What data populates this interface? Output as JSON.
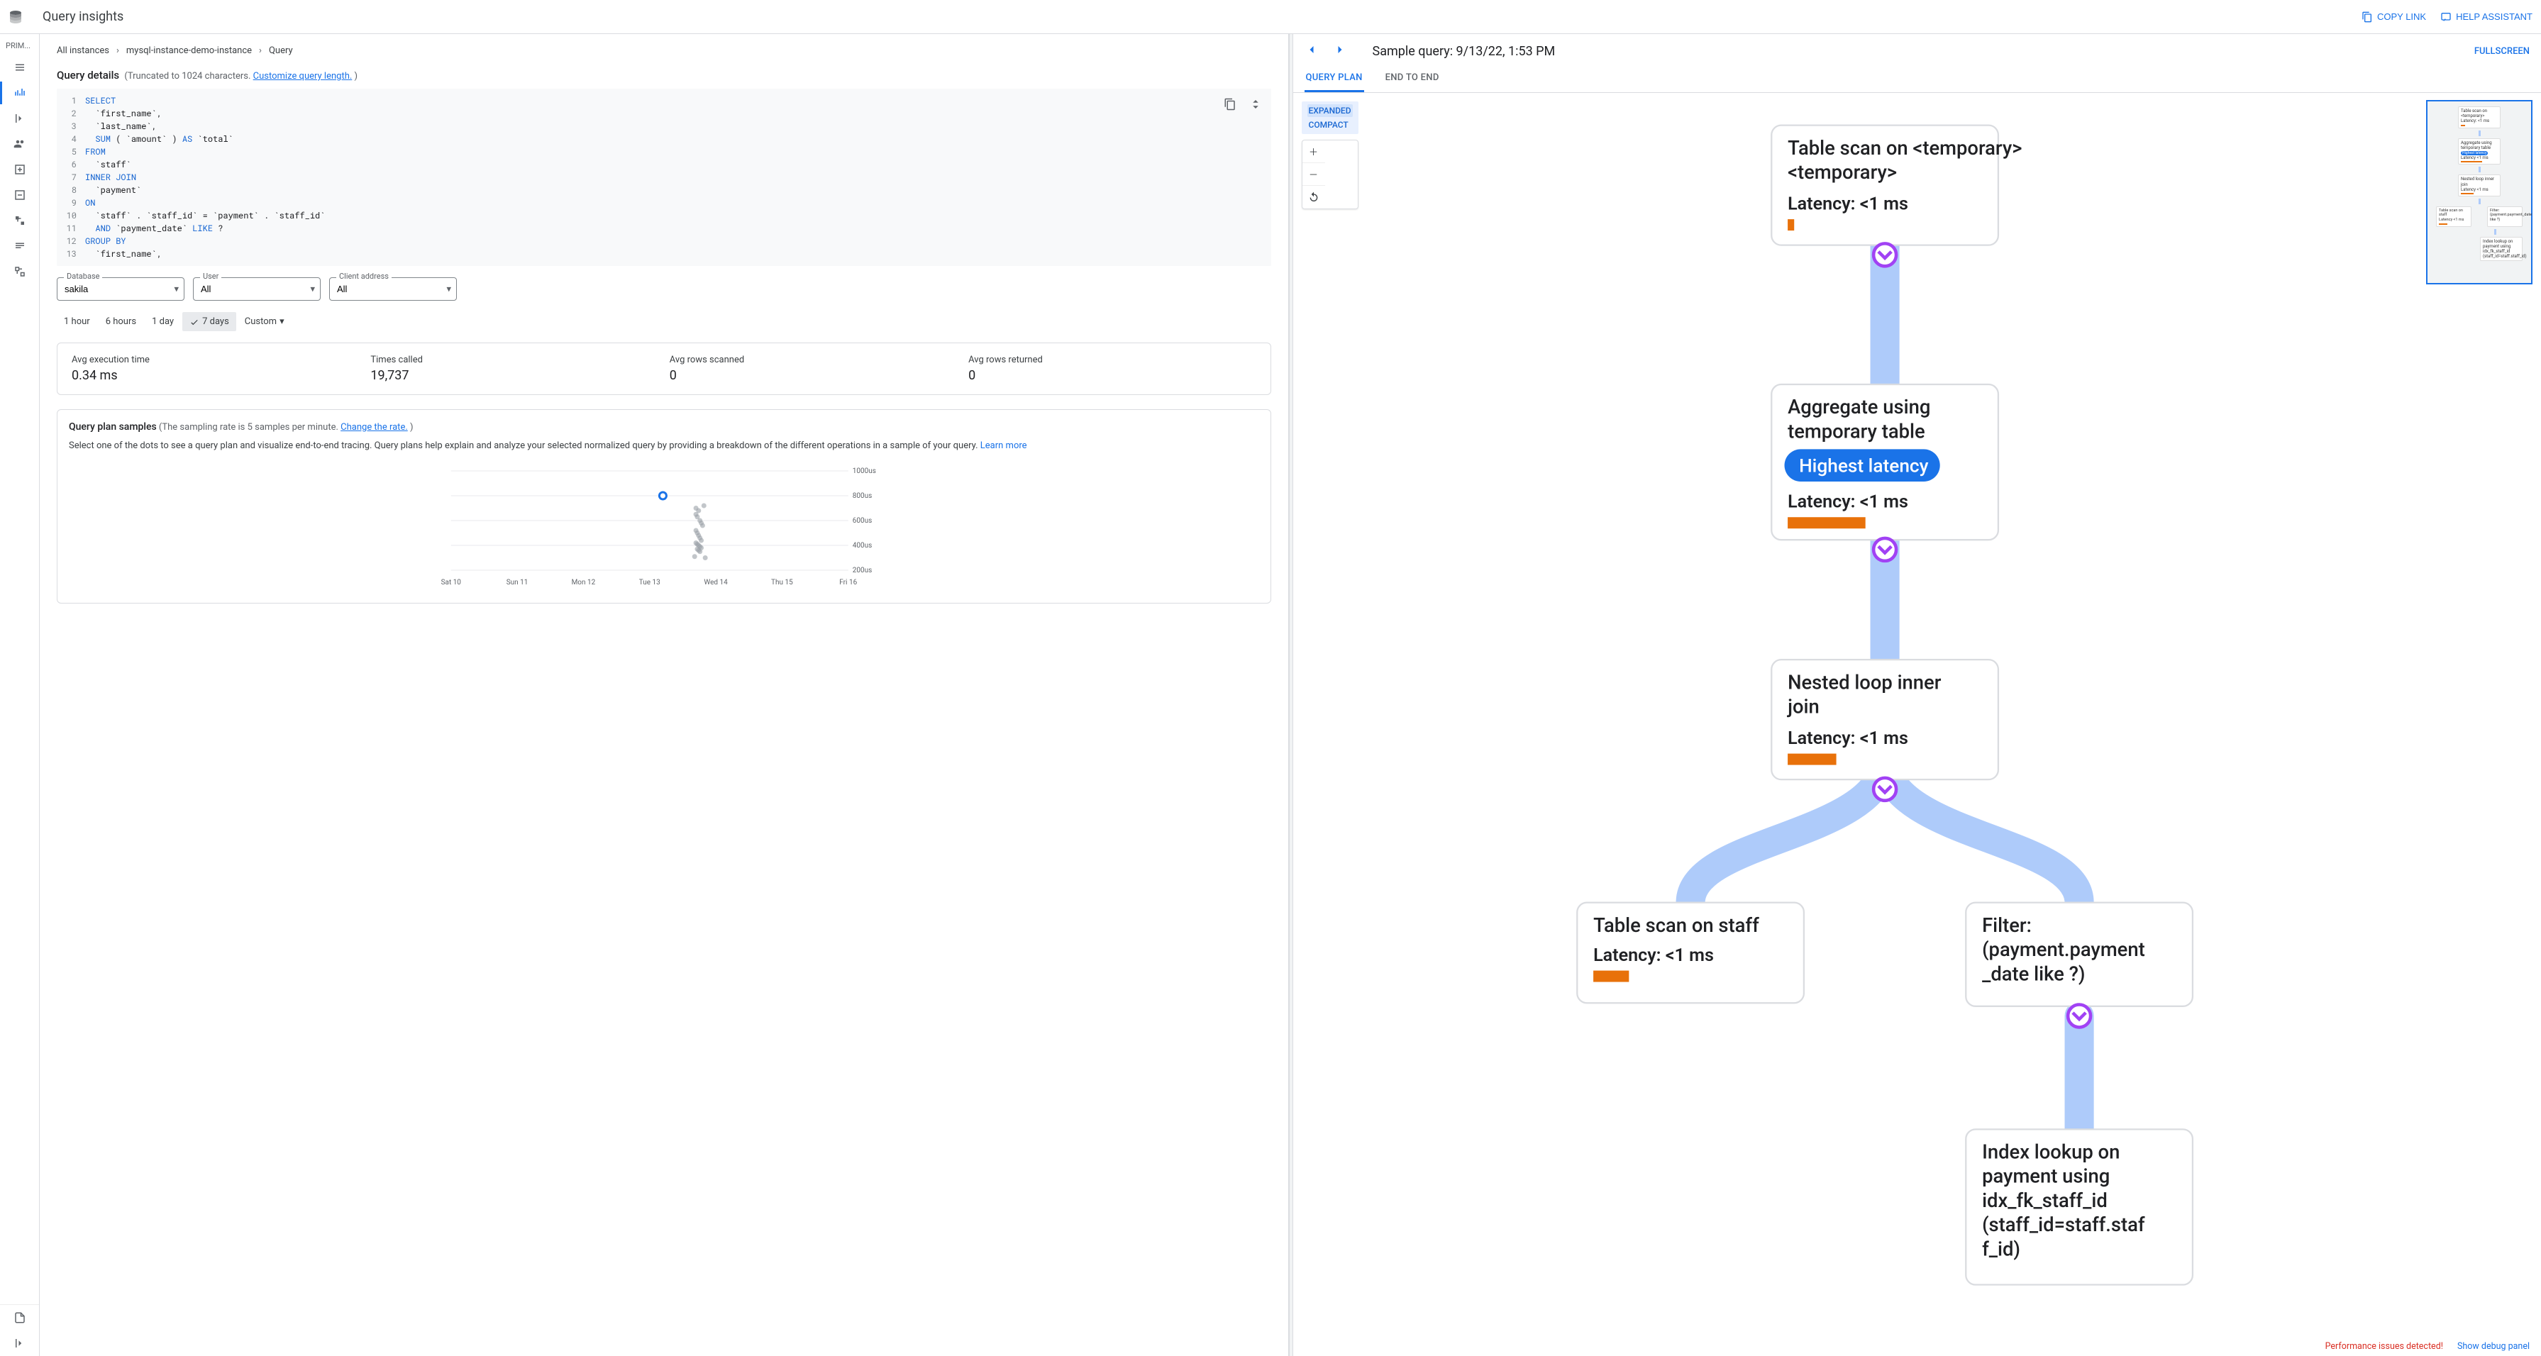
{
  "header": {
    "title": "Query insights",
    "copy_link": "COPY LINK",
    "help_assistant": "HELP ASSISTANT"
  },
  "sidebar": {
    "section_label": "PRIM..."
  },
  "breadcrumb": {
    "all": "All instances",
    "instance": "mysql-instance-demo-instance",
    "query": "Query"
  },
  "details": {
    "title": "Query details",
    "truncated": "(Truncated to 1024 characters. ",
    "customize_link": "Customize query length.",
    "close_paren": " )"
  },
  "sql": {
    "l1": "SELECT",
    "l2": "  `first_name`,",
    "l3": "  `last_name`,",
    "l4a": "  ",
    "l4k": "SUM",
    "l4b": " ( `amount` ) ",
    "l4k2": "AS",
    "l4c": " `total`",
    "l5": "FROM",
    "l6": "  `staff`",
    "l7a": "INNER",
    "l7b": " ",
    "l7c": "JOIN",
    "l8": "  `payment`",
    "l9": "ON",
    "l10": "  `staff` . `staff_id` = `payment` . `staff_id`",
    "l11a": "  ",
    "l11k": "AND",
    "l11b": " `payment_date` ",
    "l11k2": "LIKE",
    "l11c": " ?",
    "l12a": "GROUP",
    "l12b": " ",
    "l12c": "BY",
    "l13": "  `first_name`,"
  },
  "filters": {
    "db_label": "Database",
    "db_value": "sakila",
    "user_label": "User",
    "user_value": "All",
    "addr_label": "Client address",
    "addr_value": "All"
  },
  "time_ranges": {
    "h1": "1 hour",
    "h6": "6 hours",
    "d1": "1 day",
    "d7": "7 days",
    "custom": "Custom"
  },
  "stats": {
    "exec_label": "Avg execution time",
    "exec_value": "0.34 ms",
    "calls_label": "Times called",
    "calls_value": "19,737",
    "scanned_label": "Avg rows scanned",
    "scanned_value": "0",
    "returned_label": "Avg rows returned",
    "returned_value": "0"
  },
  "samples": {
    "title": "Query plan samples",
    "sub": " (The sampling rate is 5 samples per minute. ",
    "change_link": "Change the rate.",
    "close_paren": " )",
    "desc": "Select one of the dots to see a query plan and visualize end-to-end tracing. Query plans help explain and analyze your selected normalized query by providing a breakdown of the different operations in a sample of your query. ",
    "learn_more": "Learn more"
  },
  "chart_data": {
    "type": "scatter",
    "x_categories": [
      "Sat 10",
      "Sun 11",
      "Mon 12",
      "Tue 13",
      "Wed 14",
      "Thu 15",
      "Fri 16"
    ],
    "y_ticks": [
      "200us",
      "400us",
      "600us",
      "800us",
      "1000us"
    ],
    "selected_point": {
      "x": 3.2,
      "y": 800
    },
    "points": [
      {
        "x": 3.7,
        "y": 650
      },
      {
        "x": 3.72,
        "y": 630
      },
      {
        "x": 3.74,
        "y": 680
      },
      {
        "x": 3.76,
        "y": 600
      },
      {
        "x": 3.78,
        "y": 580
      },
      {
        "x": 3.8,
        "y": 560
      },
      {
        "x": 3.7,
        "y": 520
      },
      {
        "x": 3.72,
        "y": 500
      },
      {
        "x": 3.74,
        "y": 480
      },
      {
        "x": 3.76,
        "y": 460
      },
      {
        "x": 3.78,
        "y": 440
      },
      {
        "x": 3.7,
        "y": 420
      },
      {
        "x": 3.72,
        "y": 410
      },
      {
        "x": 3.74,
        "y": 400
      },
      {
        "x": 3.76,
        "y": 390
      },
      {
        "x": 3.78,
        "y": 380
      },
      {
        "x": 3.72,
        "y": 370
      },
      {
        "x": 3.74,
        "y": 360
      },
      {
        "x": 3.76,
        "y": 350
      },
      {
        "x": 3.7,
        "y": 700
      },
      {
        "x": 3.82,
        "y": 720
      },
      {
        "x": 3.84,
        "y": 300
      },
      {
        "x": 3.68,
        "y": 310
      }
    ]
  },
  "right": {
    "title": "Sample query: 9/13/22, 1:53 PM",
    "fullscreen": "FULLSCREEN",
    "tab_plan": "QUERY PLAN",
    "tab_e2e": "END TO END",
    "expanded": "EXPANDED",
    "compact": "COMPACT"
  },
  "plan_nodes": {
    "n1_title": "Table scan on <temporary>",
    "n1_lat": "Latency: <1 ms",
    "n2_title": "Aggregate using temporary table",
    "n2_badge": "Highest latency",
    "n2_lat": "Latency: <1 ms",
    "n3_title": "Nested loop inner join",
    "n3_lat": "Latency: <1 ms",
    "n4_title": "Table scan on staff",
    "n4_lat": "Latency: <1 ms",
    "n5_title": "Filter: (payment.payment_date like ?)",
    "n6_title": "Index lookup on payment using idx_fk_staff_id (staff_id=staff.staff_id)"
  },
  "minimap": {
    "n1": "Table scan on <temporary>",
    "n1l": "Latency: <1 ms",
    "n2": "Aggregate using temporary table",
    "n2b": "Highest latency",
    "n2l": "Latency <1 ms",
    "n3": "Nested loop inner join",
    "n3l": "Latency <1 ms",
    "n4": "Table scan on staff",
    "n4l": "Latency <1 ms",
    "n5": "Filter: (payment.payment_date like ?)",
    "n6": "Index lookup on payment using idx_fk_staff_id (staff_id=staff.staff_id)"
  },
  "footer": {
    "warn": "Performance issues detected!",
    "link": "Show debug panel"
  }
}
